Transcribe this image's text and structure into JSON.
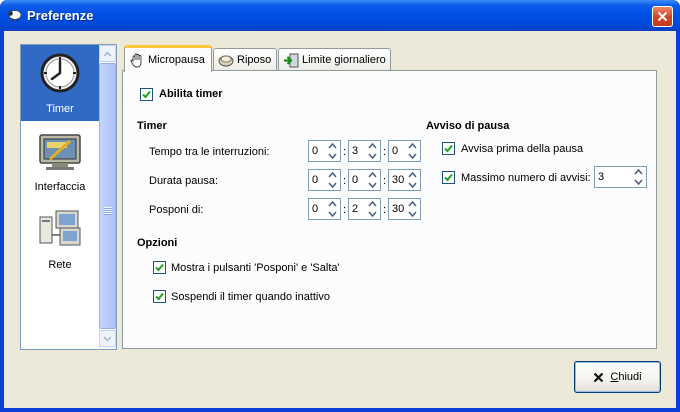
{
  "window": {
    "title": "Preferenze"
  },
  "sidebar": {
    "items": [
      {
        "label": "Timer",
        "icon": "clock-icon",
        "selected": true
      },
      {
        "label": "Interfaccia",
        "icon": "monitor-icon",
        "selected": false
      },
      {
        "label": "Rete",
        "icon": "network-icon",
        "selected": false
      }
    ]
  },
  "tabs": [
    {
      "label": "Micropausa",
      "icon": "hand-icon",
      "active": true
    },
    {
      "label": "Riposo",
      "icon": "bed-icon",
      "active": false
    },
    {
      "label": "Limite giornaliero",
      "icon": "exit-icon",
      "active": false
    }
  ],
  "micropausa": {
    "enable_timer": {
      "label": "Abilita timer",
      "checked": true
    },
    "timer_section": {
      "heading": "Timer",
      "rows": [
        {
          "label": "Tempo tra le interruzioni:",
          "values": [
            "0",
            "3",
            "0"
          ]
        },
        {
          "label": "Durata pausa:",
          "values": [
            "0",
            "0",
            "30"
          ]
        },
        {
          "label": "Posponi di:",
          "values": [
            "0",
            "2",
            "30"
          ]
        }
      ],
      "separator": ":"
    },
    "warning_section": {
      "heading": "Avviso di pausa",
      "warn_before": {
        "label": "Avvisa prima della pausa",
        "checked": true
      },
      "max_warnings": {
        "label": "Massimo numero di avvisi:",
        "checked": true,
        "value": "3"
      }
    },
    "options_section": {
      "heading": "Opzioni",
      "show_buttons": {
        "label": "Mostra i pulsanti 'Posponi' e 'Salta'",
        "checked": true
      },
      "suspend_idle": {
        "label": "Sospendi il timer quando inattivo",
        "checked": true
      }
    }
  },
  "footer": {
    "close_label": "Chiudi",
    "close_mnemonic": "C",
    "close_rest": "hiudi"
  },
  "colors": {
    "titlebar": "#0050e6",
    "selection": "#316ac5",
    "checkmark": "#21a121",
    "close_red": "#d5452a"
  }
}
